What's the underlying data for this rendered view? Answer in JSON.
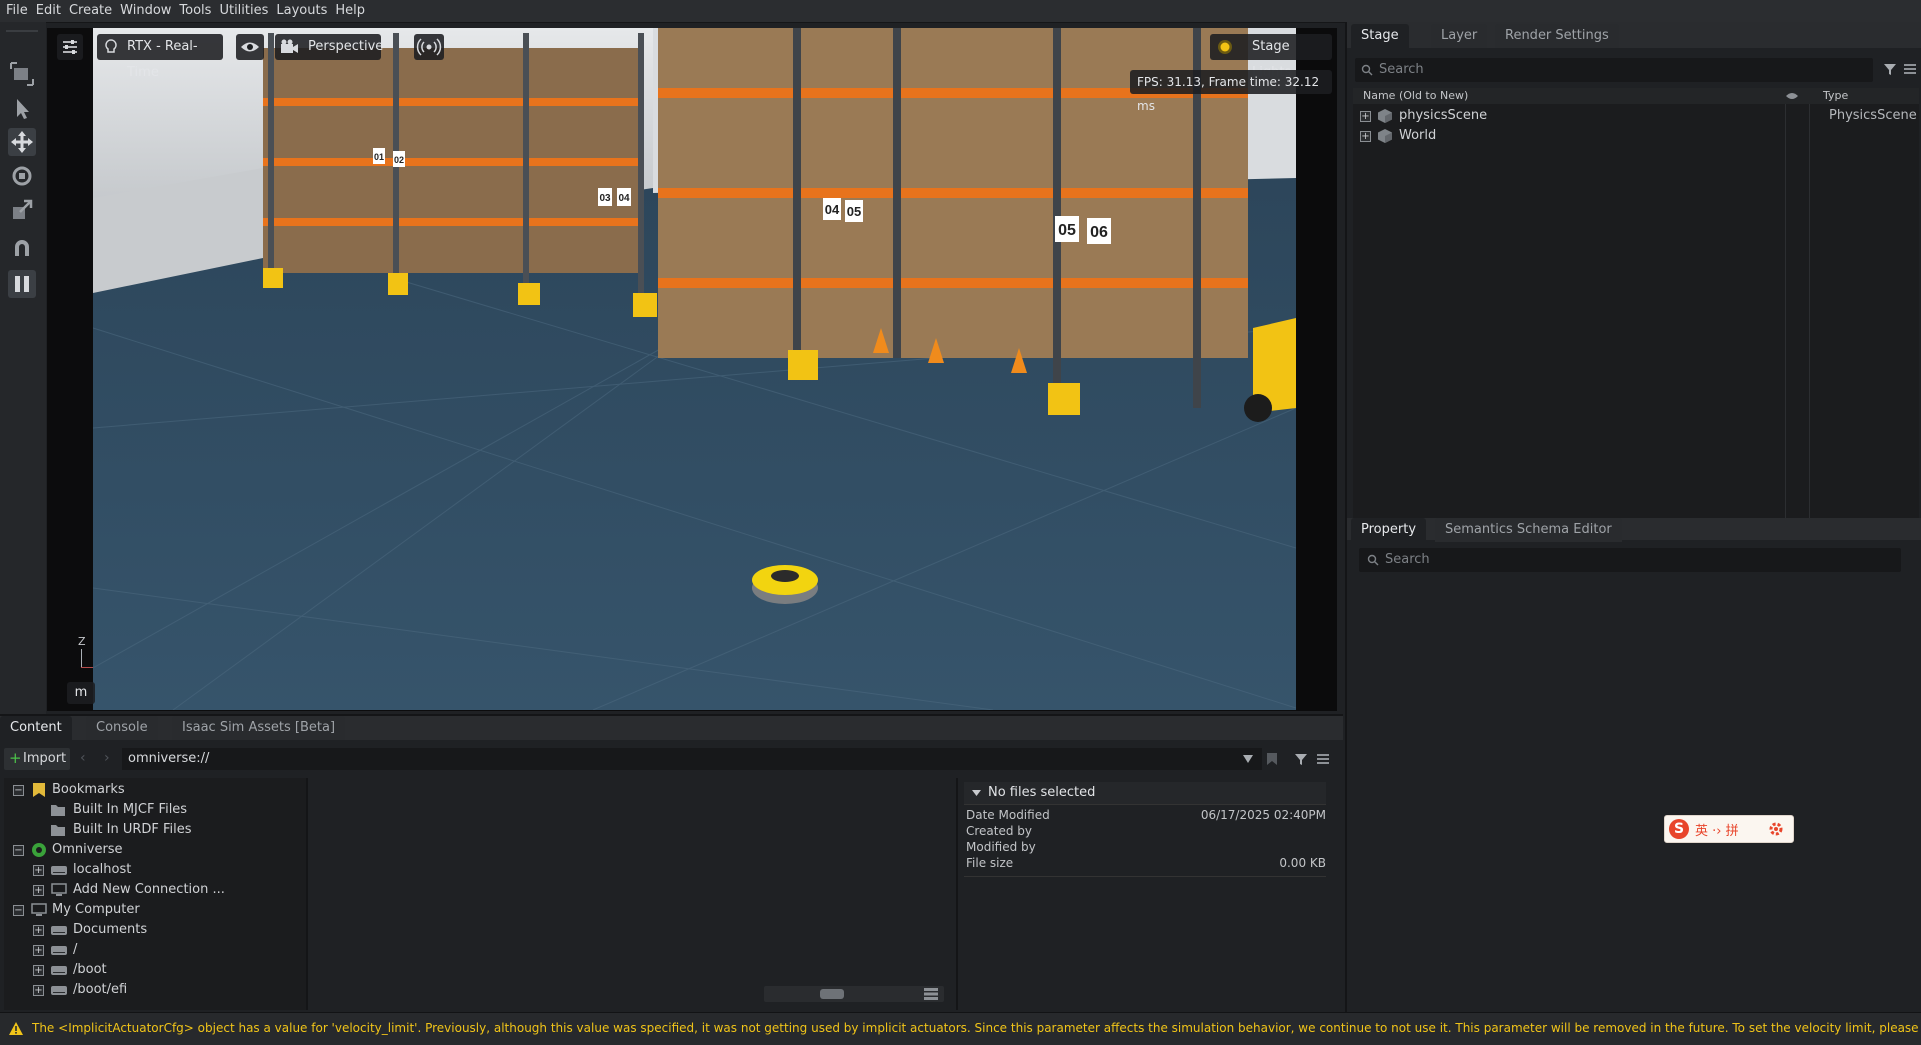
{
  "menu": [
    "File",
    "Edit",
    "Create",
    "Window",
    "Tools",
    "Utilities",
    "Layouts",
    "Help"
  ],
  "viewport": {
    "renderer_label": "RTX - Real-Time",
    "camera_label": "Perspective",
    "lights_label": "Stage Lights",
    "fps_text": "FPS: 31.13, Frame time: 32.12 ms",
    "axis_z": "Z",
    "unit_button": "m",
    "rack_labels": [
      "01",
      "02",
      "03",
      "04",
      "04",
      "05",
      "05",
      "06"
    ]
  },
  "stage_panel": {
    "tabs": [
      "Stage",
      "Layer",
      "Render Settings"
    ],
    "search_placeholder": "Search",
    "col_name": "Name (Old to New)",
    "col_type": "Type",
    "items": [
      {
        "name": "physicsScene",
        "type": "PhysicsScene"
      },
      {
        "name": "World",
        "type": ""
      }
    ]
  },
  "property_panel": {
    "tabs": [
      "Property",
      "Semantics Schema Editor"
    ],
    "search_placeholder": "Search",
    "ime_text": "英 ·› 拼"
  },
  "content_panel": {
    "tabs": [
      "Content",
      "Console",
      "Isaac Sim Assets [Beta]"
    ],
    "import_label": "Import",
    "path": "omniverse://",
    "tree": [
      {
        "label": "Bookmarks",
        "level": 0,
        "toggle": "−"
      },
      {
        "label": "Built In MJCF Files",
        "level": 1,
        "toggle": ""
      },
      {
        "label": "Built In URDF Files",
        "level": 1,
        "toggle": ""
      },
      {
        "label": "Omniverse",
        "level": 0,
        "toggle": "−"
      },
      {
        "label": "localhost",
        "level": 1,
        "toggle": "+"
      },
      {
        "label": "Add New Connection ...",
        "level": 1,
        "toggle": "+"
      },
      {
        "label": "My Computer",
        "level": 0,
        "toggle": "−"
      },
      {
        "label": "Documents",
        "level": 1,
        "toggle": "+"
      },
      {
        "label": "/",
        "level": 1,
        "toggle": "+"
      },
      {
        "label": "/boot",
        "level": 1,
        "toggle": "+"
      },
      {
        "label": "/boot/efi",
        "level": 1,
        "toggle": "+"
      }
    ],
    "details": {
      "header": "No files selected",
      "rows": [
        {
          "label": "Date Modified",
          "value": "06/17/2025 02:40PM"
        },
        {
          "label": "Created by",
          "value": ""
        },
        {
          "label": "Modified by",
          "value": ""
        },
        {
          "label": "File size",
          "value": "0.00 KB"
        }
      ]
    }
  },
  "status": {
    "message": "The <ImplicitActuatorCfg> object has a value for 'velocity_limit'. Previously, although this value was specified, it was not getting used by implicit actuators. Since this parameter affects the simulation behavior, we continue to not use it. This parameter will be removed in the future. To set the velocity limit, please use 'velocity_limit"
  },
  "colors": {
    "accent_yellow": "#f2c314",
    "warning": "#f0c419",
    "floor": "#2c4459",
    "rack_orange": "#e8731c"
  }
}
